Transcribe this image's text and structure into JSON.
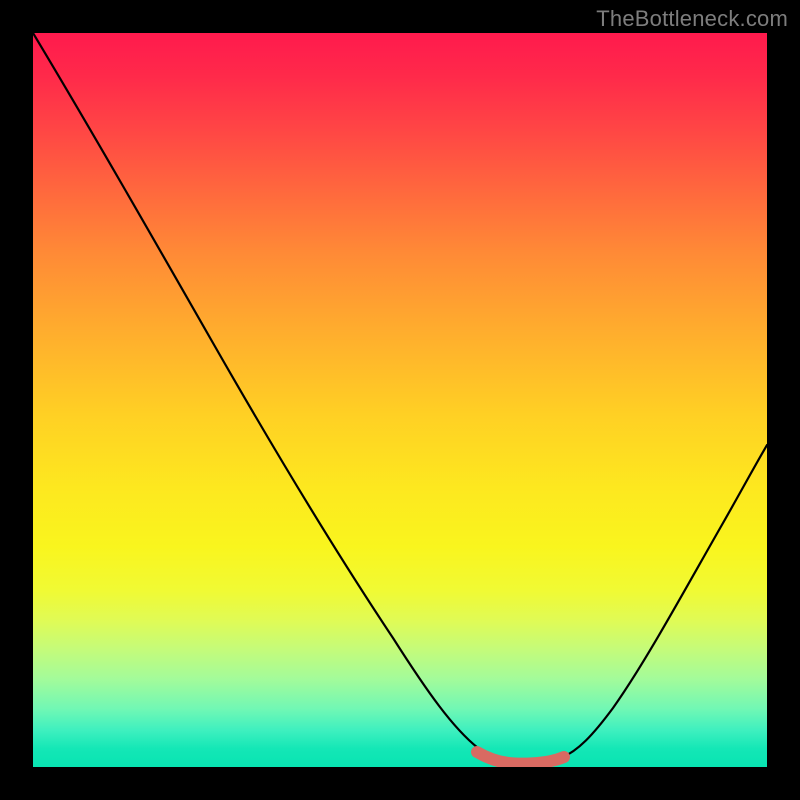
{
  "watermark": "TheBottleneck.com",
  "colors": {
    "line": "#000000",
    "marker": "#d96a62"
  },
  "chart_data": {
    "type": "line",
    "title": "",
    "xlabel": "",
    "ylabel": "",
    "xlim": [
      0,
      100
    ],
    "ylim": [
      0,
      100
    ],
    "x": [
      0,
      5,
      10,
      15,
      20,
      25,
      30,
      35,
      40,
      45,
      50,
      55,
      60,
      62,
      64,
      66,
      68,
      70,
      72,
      75,
      80,
      85,
      90,
      95,
      100
    ],
    "values": [
      100,
      91,
      82,
      73,
      64,
      55,
      47,
      39,
      31,
      24,
      17,
      11,
      6,
      4,
      2.5,
      1.5,
      1,
      1,
      1.5,
      3,
      8,
      16,
      26,
      38,
      52
    ],
    "marker_range_x": [
      60.5,
      72
    ],
    "marker_y": 1,
    "notes": "V-shaped bottleneck curve: high mismatch (red) at edges, optimal (green) near x≈66–70. No numeric tick labels are rendered in the image; values are estimated from curve geometry on a 0–100 normalized scale."
  }
}
